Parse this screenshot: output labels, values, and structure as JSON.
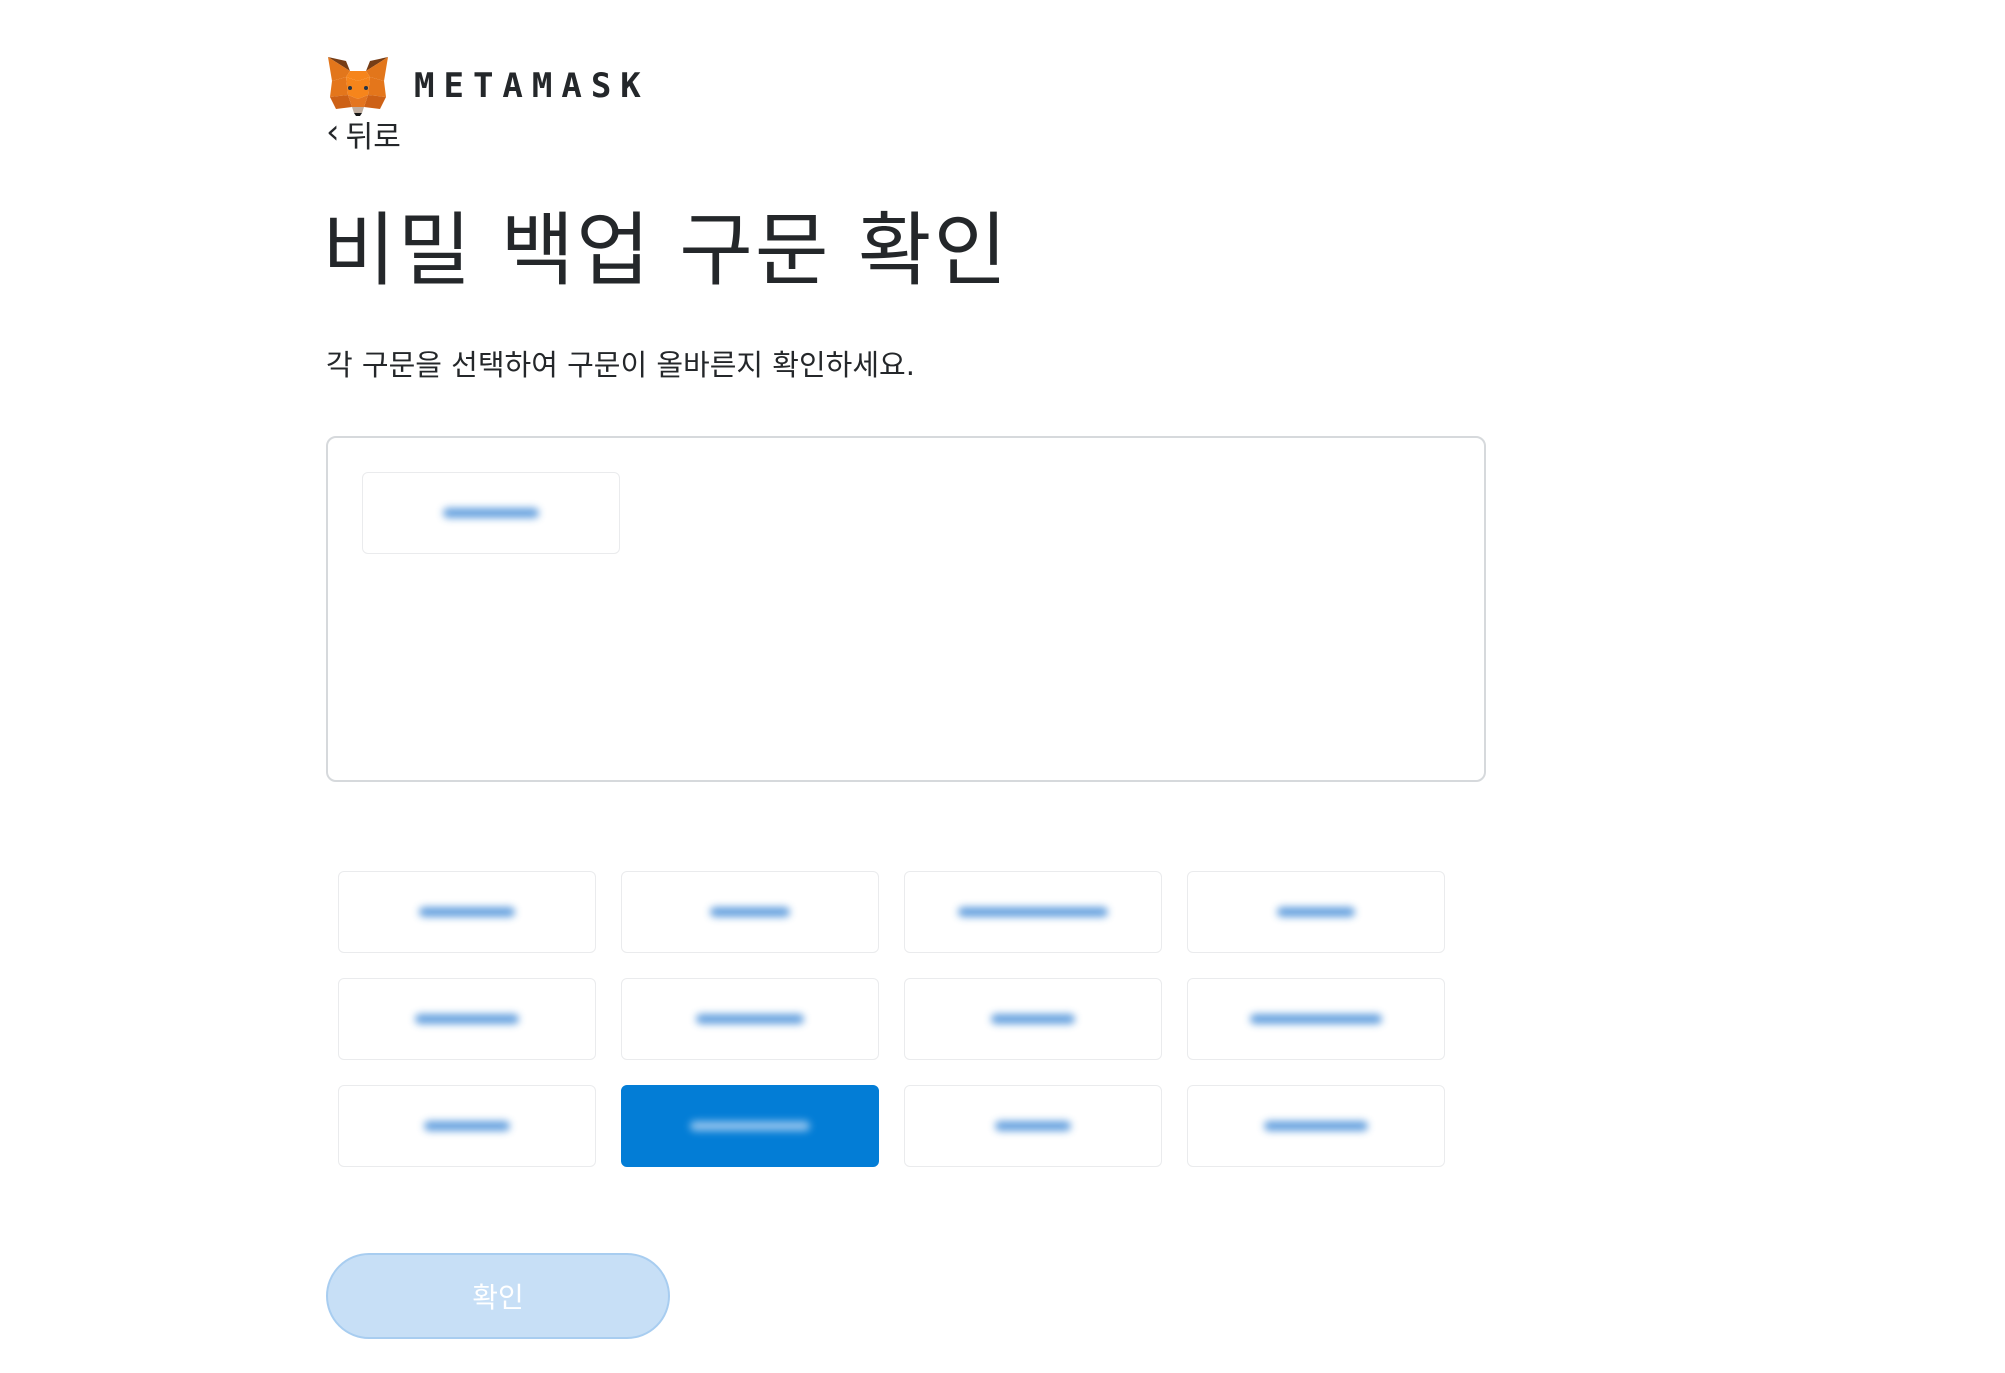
{
  "header": {
    "brand": "METAMASK",
    "logo_icon": "metamask-fox-icon"
  },
  "nav": {
    "back_label": "뒤로",
    "back_icon": "chevron-left-icon"
  },
  "main": {
    "title": "비밀 백업 구문 확인",
    "subtitle": "각 구문을 선택하여 구문이 올바른지 확인하세요.",
    "selected_words_count": 1,
    "word_grid": {
      "rows": 3,
      "columns": 4,
      "highlighted_index": 9,
      "note": ""
    },
    "confirm_label": "확인",
    "confirm_enabled": false
  },
  "colors": {
    "accent": "#037dd6",
    "disabled_button_bg": "#c7dff6",
    "border": "#d6d9dc",
    "text": "#24272a"
  }
}
